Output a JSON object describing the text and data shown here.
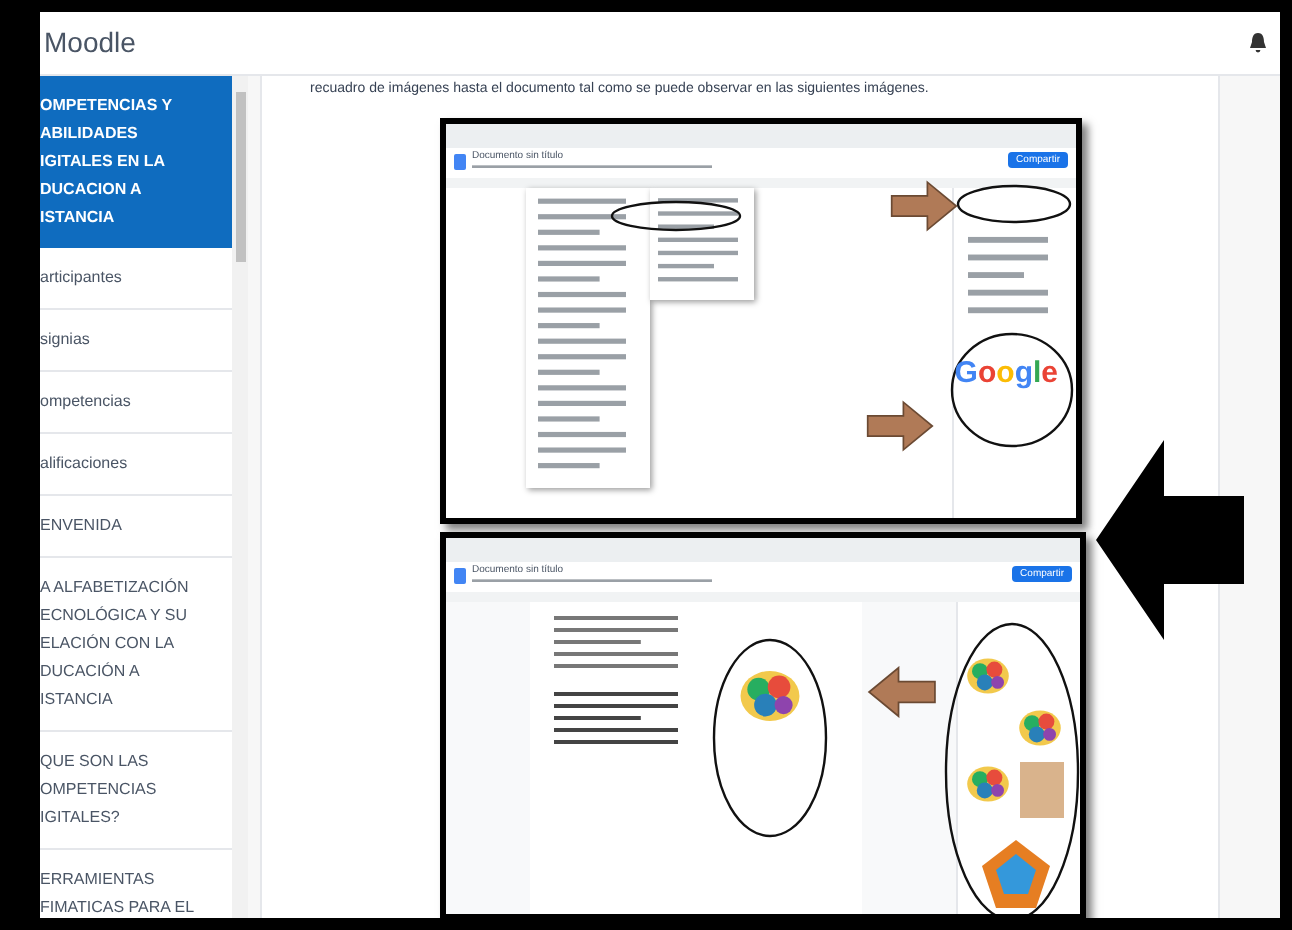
{
  "header": {
    "title": "Moodle"
  },
  "sidebar": {
    "items": [
      {
        "lines": [
          "OMPETENCIAS Y",
          "ABILIDADES",
          "IGITALES EN LA",
          "DUCACION A",
          "ISTANCIA"
        ],
        "selected": true
      },
      {
        "lines": [
          "articipantes"
        ],
        "selected": false
      },
      {
        "lines": [
          "signias"
        ],
        "selected": false
      },
      {
        "lines": [
          "ompetencias"
        ],
        "selected": false
      },
      {
        "lines": [
          "alificaciones"
        ],
        "selected": false
      },
      {
        "lines": [
          "ENVENIDA"
        ],
        "selected": false
      },
      {
        "lines": [
          "A ALFABETIZACIÓN",
          "ECNOLÓGICA Y SU",
          "ELACIÓN CON LA",
          "DUCACIÓN A",
          "ISTANCIA"
        ],
        "selected": false
      },
      {
        "lines": [
          "QUE SON LAS",
          "OMPETENCIAS",
          "IGITALES?"
        ],
        "selected": false
      },
      {
        "lines": [
          "ERRAMIENTAS",
          "FIMATICAS PARA EL"
        ],
        "selected": false
      }
    ]
  },
  "content": {
    "intro": "recuadro de imágenes hasta el documento tal como se puede observar en las siguientes imágenes.",
    "screenshots": [
      {
        "kind": "menu",
        "doc_title": "Documento sin título",
        "share": "Compartir",
        "logo": "Google"
      },
      {
        "kind": "images",
        "doc_title": "Documento sin título",
        "share": "Compartir"
      }
    ]
  }
}
